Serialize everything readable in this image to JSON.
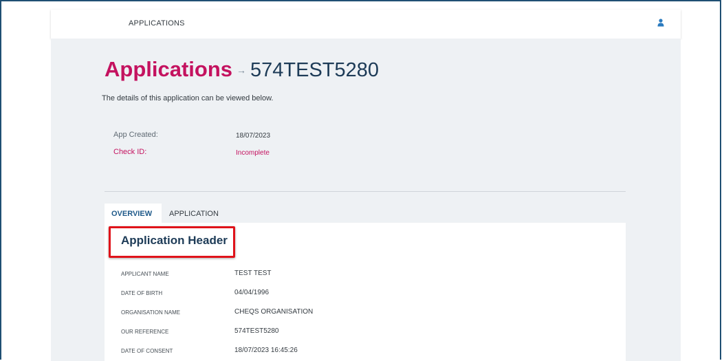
{
  "header": {
    "nav_label": "APPLICATIONS",
    "user_icon": "user-icon"
  },
  "page": {
    "breadcrumb": "Applications",
    "arrow": "→",
    "reference": "574TEST5280",
    "description": "The details of this application can be viewed below."
  },
  "meta": {
    "app_created_label": "App Created:",
    "app_created_value": "18/07/2023",
    "check_id_label": "Check ID:",
    "check_id_value": "Incomplete"
  },
  "tabs": [
    {
      "label": "OVERVIEW",
      "active": true
    },
    {
      "label": "APPLICATION",
      "active": false
    }
  ],
  "section": {
    "title": "Application Header",
    "fields": [
      {
        "label": "APPLICANT NAME",
        "value": "TEST TEST"
      },
      {
        "label": "DATE OF BIRTH",
        "value": "04/04/1996"
      },
      {
        "label": "ORGANISATION NAME",
        "value": "CHEQS ORGANISATION"
      },
      {
        "label": "OUR REFERENCE",
        "value": "574TEST5280"
      },
      {
        "label": "DATE OF CONSENT",
        "value": "18/07/2023 16:45:26"
      }
    ]
  },
  "colors": {
    "accent": "#c4125f",
    "heading": "#1d3b57",
    "highlight": "#e0131a",
    "frame": "#1f4f73"
  }
}
